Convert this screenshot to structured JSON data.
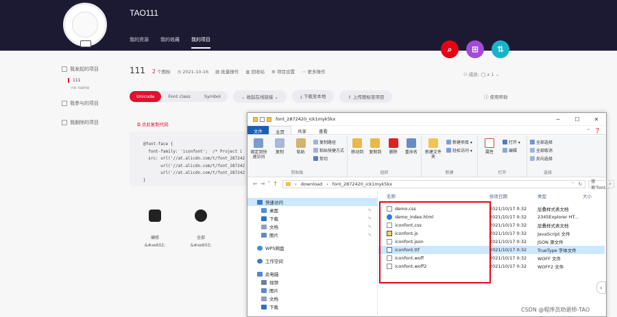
{
  "header": {
    "site_title": "TAO111",
    "tabs": [
      "我的资源",
      "我的收藏",
      "我的项目"
    ],
    "active_tab": "我的项目",
    "colors": {
      "bg": "#1c1a33",
      "search": "#e60012",
      "add": "#a24bd6",
      "sort": "#19b3c8"
    }
  },
  "sidebar": {
    "items": [
      {
        "label": "我发起的项目",
        "icon": "folder-icon"
      },
      {
        "label": "我参与的项目",
        "icon": "folder-icon"
      },
      {
        "label": "我删除的项目",
        "icon": "trash-icon"
      }
    ],
    "sub_active": "111",
    "sub_other": "no name"
  },
  "project": {
    "name": "111",
    "count": "2",
    "count_unit": "个图标",
    "date": "2021-10-16",
    "actions": [
      "批量操作",
      "回收站",
      "项目设置",
      "更多操作"
    ],
    "members": "成员:",
    "member_count": "x 1",
    "chevron": "⌄"
  },
  "toolbar": {
    "formats": [
      "Unicode",
      "Font class",
      "Symbol"
    ],
    "active_format": "Unicode",
    "link_btn": "收起在线链接",
    "download_btn": "下载至本地",
    "upload_btn": "上传图标至项目",
    "help": "使用帮助"
  },
  "code": {
    "hint": "点此复制代码",
    "text": "@font-face {\n  font-family: 'iconfont';  /* Project i\n  src: url('//at.alicdn.com/t/font_287242\n       url('//at.alicdn.com/t/font_287242\n       url('//at.alicdn.com/t/font_287242\n}"
  },
  "icons": [
    {
      "name": "编修",
      "code": "&#xe602;"
    },
    {
      "name": "全部",
      "code": "&#xe603;"
    }
  ],
  "explorer": {
    "title": "font_2872420_ick1myk5kx",
    "window_controls": [
      "─",
      "☐",
      "✕"
    ],
    "ribbon_tabs": [
      "文件",
      "主页",
      "共享",
      "查看"
    ],
    "ribbon_groups": {
      "clipboard": {
        "name": "剪贴板",
        "big": [
          "固定到快速访问",
          "复制",
          "粘贴"
        ],
        "small": [
          "复制路径",
          "粘贴快捷方式",
          "剪切"
        ]
      },
      "organize": {
        "name": "组织",
        "big": [
          "移动到",
          "复制到",
          "删除",
          "重命名"
        ]
      },
      "new": {
        "name": "新建",
        "big": [
          "新建文件夹"
        ],
        "small": [
          "新建项目 ▾",
          "轻松访问 ▾"
        ]
      },
      "open": {
        "name": "打开",
        "big": [
          "属性"
        ],
        "small": [
          "打开 ▾",
          "编辑"
        ]
      },
      "select": {
        "name": "选择",
        "small": [
          "全部选择",
          "全部取消",
          "反向选择"
        ]
      }
    },
    "address": {
      "segments": [
        "download",
        "font_2872420_ick1myk5kx"
      ],
      "search_placeholder": "搜索\"font...",
      "nav_buttons": [
        "←",
        "→",
        "˅",
        "↑"
      ],
      "dropdown": "˅",
      "refresh": "↻"
    },
    "nav_pane": [
      {
        "label": "快速访问",
        "type": "group",
        "selected": true
      },
      {
        "label": "桌面",
        "type": "sub",
        "pinned": true
      },
      {
        "label": "下载",
        "type": "sub",
        "pinned": true
      },
      {
        "label": "文档",
        "type": "sub",
        "pinned": true
      },
      {
        "label": "图片",
        "type": "sub",
        "pinned": true
      },
      {
        "label": "WPS网盘",
        "type": "group"
      },
      {
        "label": "工作空间",
        "type": "group"
      },
      {
        "label": "此电脑",
        "type": "group"
      },
      {
        "label": "视频",
        "type": "sub"
      },
      {
        "label": "图片",
        "type": "sub"
      },
      {
        "label": "文档",
        "type": "sub"
      },
      {
        "label": "下载",
        "type": "sub"
      }
    ],
    "columns": [
      "名称",
      "修改日期",
      "类型",
      "大小"
    ],
    "files": [
      {
        "name": "demo.css",
        "date": "2021/10/17 0:32",
        "type": "层叠样式表文档"
      },
      {
        "name": "demo_index.html",
        "date": "2021/10/17 0:32",
        "type": "2345Explorer HT..."
      },
      {
        "name": "iconfont.css",
        "date": "2021/10/17 0:32",
        "type": "层叠样式表文档"
      },
      {
        "name": "iconfont.js",
        "date": "2021/10/17 0:32",
        "type": "JavaScript 文件"
      },
      {
        "name": "iconfont.json",
        "date": "2021/10/17 0:32",
        "type": "JSON 源文件"
      },
      {
        "name": "iconfont.ttf",
        "date": "2021/10/17 0:32",
        "type": "TrueType 字体文件",
        "selected": true
      },
      {
        "name": "iconfont.woff",
        "date": "2021/10/17 0:32",
        "type": "WOFF 文件"
      },
      {
        "name": "iconfont.woff2",
        "date": "2021/10/17 0:32",
        "type": "WOFF2 文件"
      }
    ]
  },
  "watermark": "CSDN @程序员劝退师-TAO"
}
